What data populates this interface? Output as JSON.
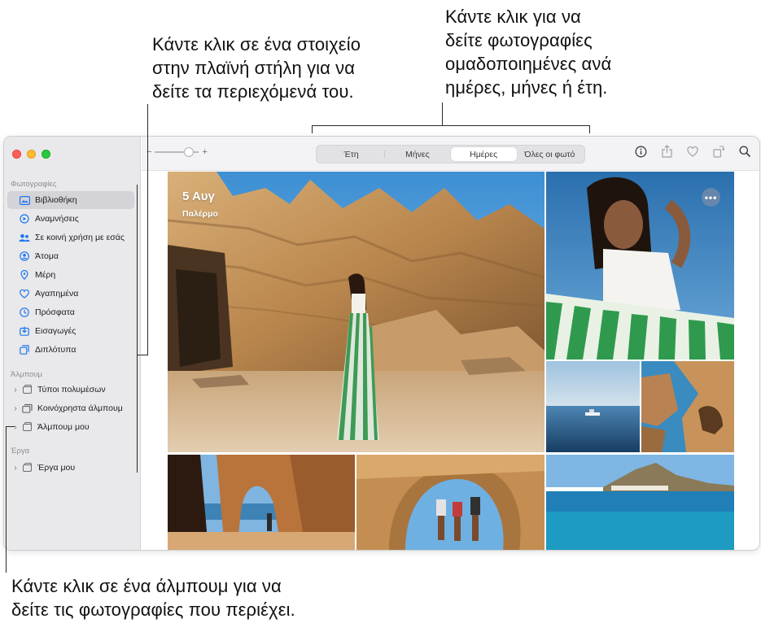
{
  "callouts": {
    "sidebar": [
      "Κάντε κλικ σε ένα στοιχείο",
      "στην πλαϊνή στήλη για να",
      "δείτε τα περιεχόμενά του."
    ],
    "grouping": [
      "Κάντε κλικ για να",
      "δείτε φωτογραφίες",
      "ομαδοποιημένες ανά",
      "ημέρες, μήνες ή έτη."
    ],
    "album": [
      "Κάντε κλικ σε ένα άλμπουμ για να",
      "δείτε τις φωτογραφίες που περιέχει."
    ]
  },
  "sidebar": {
    "photos_section": "Φωτογραφίες",
    "items": [
      {
        "label": "Βιβλιοθήκη",
        "icon": "library-icon"
      },
      {
        "label": "Αναμνήσεις",
        "icon": "memories-icon"
      },
      {
        "label": "Σε κοινή χρήση με εσάς",
        "icon": "shared-with-you-icon"
      },
      {
        "label": "Άτομα",
        "icon": "people-icon"
      },
      {
        "label": "Μέρη",
        "icon": "places-icon"
      },
      {
        "label": "Αγαπημένα",
        "icon": "heart-icon"
      },
      {
        "label": "Πρόσφατα",
        "icon": "clock-icon"
      },
      {
        "label": "Εισαγωγές",
        "icon": "imports-icon"
      },
      {
        "label": "Διπλότυπα",
        "icon": "duplicates-icon"
      }
    ],
    "albums_section": "Άλμπουμ",
    "albums": [
      {
        "label": "Τύποι πολυμέσων"
      },
      {
        "label": "Κοινόχρηστα άλμπουμ"
      },
      {
        "label": "Άλμπουμ μου"
      }
    ],
    "projects_section": "Έργα",
    "projects": [
      {
        "label": "Έργα μου"
      }
    ]
  },
  "toolbar": {
    "zoom_minus": "−",
    "zoom_plus": "+",
    "zoom_level": 0.7,
    "tabs": [
      "Έτη",
      "Μήνες",
      "Ημέρες",
      "Όλες οι φωτό"
    ],
    "active_tab": "Ημέρες"
  },
  "grid": {
    "date": "5 Αυγ",
    "place": "Παλέρμο",
    "more": "•••"
  },
  "colors": {
    "accent": "#1b76f2",
    "sidebar_bg": "#e9e8ea",
    "toolbar_bg": "#f3f2f4"
  }
}
